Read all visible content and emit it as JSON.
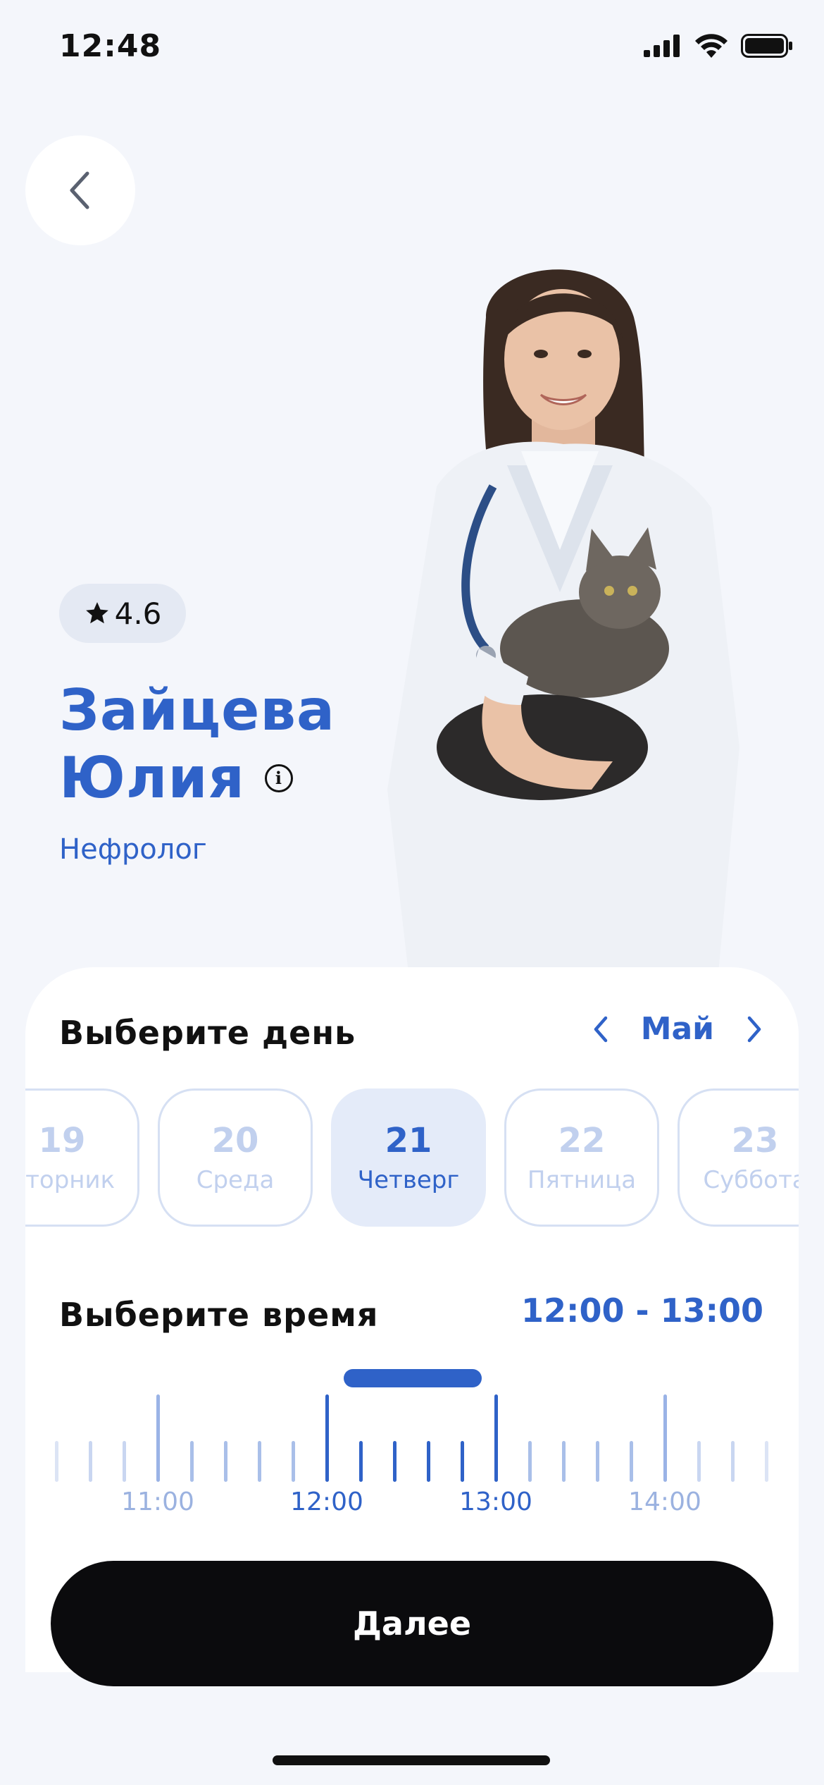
{
  "status": {
    "time": "12:48"
  },
  "doctor": {
    "rating": "4.6",
    "name_line1": "Зайцева",
    "name_line2": "Юлия",
    "specialty": "Нефролог"
  },
  "day_picker": {
    "title": "Выберите день",
    "month": "Май",
    "days": [
      {
        "num": "19",
        "name": "Вторник",
        "selected": false
      },
      {
        "num": "20",
        "name": "Среда",
        "selected": false
      },
      {
        "num": "21",
        "name": "Четверг",
        "selected": true
      },
      {
        "num": "22",
        "name": "Пятница",
        "selected": false
      },
      {
        "num": "23",
        "name": "Суббота",
        "selected": false
      }
    ]
  },
  "time_picker": {
    "title": "Выберите время",
    "selected_range": "12:00 - 13:00",
    "hour_labels": [
      "11:00",
      "12:00",
      "13:00",
      "14:00"
    ]
  },
  "actions": {
    "next_label": "Далее"
  },
  "colors": {
    "accent": "#2F62C8",
    "background": "#F4F6FB",
    "button": "#0B0B0D"
  }
}
